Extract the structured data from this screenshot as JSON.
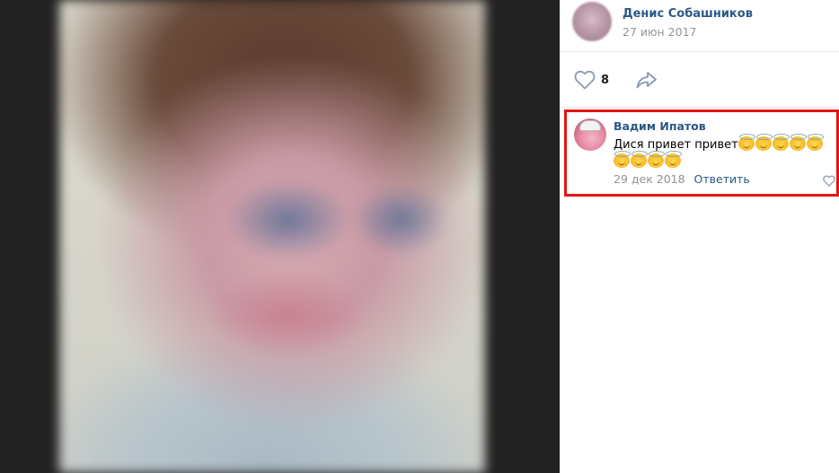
{
  "post": {
    "author": "Денис Собашников",
    "date": "27 июн 2017",
    "likes": "8"
  },
  "comment": {
    "author": "Вадим Ипатов",
    "text": "Дися привет привет",
    "emoji_count": 9,
    "emoji_icon": "angel-smiley-emoji",
    "date": "29 дек 2018",
    "reply_label": "Ответить"
  },
  "colors": {
    "link": "#2a5885",
    "meta": "#939393",
    "highlight": "#e31515"
  }
}
